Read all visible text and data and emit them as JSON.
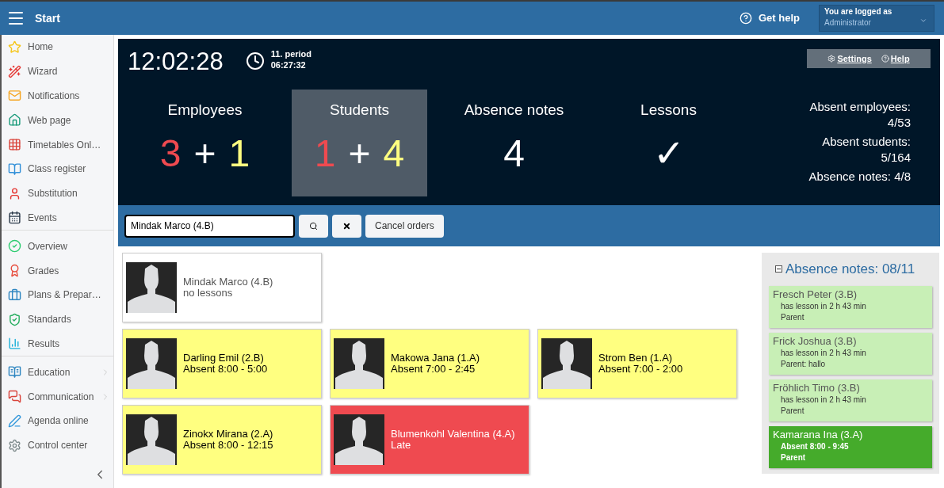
{
  "topbar": {
    "title": "Start",
    "help": "Get help",
    "user_label": "You are logged as",
    "user_name": "Administrator"
  },
  "sidebar": {
    "groups": [
      {
        "items": [
          {
            "label": "Home",
            "has_submenu": false
          },
          {
            "label": "Wizard",
            "has_submenu": false
          },
          {
            "label": "Notifications",
            "has_submenu": false
          },
          {
            "label": "Web page",
            "has_submenu": false
          },
          {
            "label": "Timetables Onl…",
            "has_submenu": false
          },
          {
            "label": "Class register",
            "has_submenu": false
          },
          {
            "label": "Substitution",
            "has_submenu": false
          },
          {
            "label": "Events",
            "has_submenu": false
          }
        ]
      },
      {
        "items": [
          {
            "label": "Overview",
            "has_submenu": false
          },
          {
            "label": "Grades",
            "has_submenu": false
          },
          {
            "label": "Plans & Prepar…",
            "has_submenu": false
          },
          {
            "label": "Standards",
            "has_submenu": false
          },
          {
            "label": "Results",
            "has_submenu": false
          }
        ]
      },
      {
        "items": [
          {
            "label": "Education",
            "has_submenu": true
          },
          {
            "label": "Communication",
            "has_submenu": true
          },
          {
            "label": "Agenda online",
            "has_submenu": false
          },
          {
            "label": "Control center",
            "has_submenu": false
          }
        ]
      }
    ]
  },
  "dashboard": {
    "clock": "12:02:28",
    "period": "11. period",
    "period_time": "06:27:32",
    "settings": "Settings",
    "help": "Help",
    "tiles": [
      {
        "title": "Employees",
        "selected": false,
        "parts": [
          {
            "text": "3",
            "color": "#ef4a50"
          },
          {
            "text": "+",
            "color": "#ffffff"
          },
          {
            "text": "1",
            "color": "#ffff80"
          }
        ]
      },
      {
        "title": "Students",
        "selected": true,
        "parts": [
          {
            "text": "1",
            "color": "#ef4a50"
          },
          {
            "text": "+",
            "color": "#ffffff"
          },
          {
            "text": "4",
            "color": "#ffff80"
          }
        ]
      },
      {
        "title": "Absence notes",
        "selected": false,
        "parts": [
          {
            "text": "4",
            "color": "#ffffff"
          }
        ]
      },
      {
        "title": "Lessons",
        "selected": false,
        "parts": [
          {
            "text": "✓",
            "color": "#ffffff"
          }
        ]
      }
    ],
    "stats": [
      "Absent employees: 4/53",
      "Absent students: 5/164",
      "Absence notes: 4/8"
    ]
  },
  "search": {
    "value": "Mindak Marco (4.B)",
    "cancel": "Cancel orders"
  },
  "people": [
    [
      {
        "name": "Mindak Marco (4.B)",
        "status_text": "no lessons",
        "kind": "none"
      }
    ],
    [
      {
        "name": "Darling Emil (2.B)",
        "status_text": "Absent 8:00 - 5:00",
        "kind": "absent"
      },
      {
        "name": "Makowa Jana (1.A)",
        "status_text": "Absent 7:00 - 2:45",
        "kind": "absent"
      },
      {
        "name": "Strom Ben (1.A)",
        "status_text": "Absent 7:00 - 2:00",
        "kind": "absent"
      }
    ],
    [
      {
        "name": "Zinokx Mirana (2.A)",
        "status_text": "Absent 8:00 - 12:15",
        "kind": "absent"
      },
      {
        "name": "Blumenkohl Valentina (4.A)",
        "status_text": "Late",
        "kind": "late"
      }
    ]
  ],
  "absence_notes": {
    "title": "Absence notes: 08/11",
    "expanded": true,
    "notes": [
      {
        "name": "Fresch Peter (3.B)",
        "detail": "has lesson in 2 h 43 min",
        "source": "Parent",
        "highlighted": false
      },
      {
        "name": "Frick Joshua (3.B)",
        "detail": "has lesson in 2 h 43 min",
        "source": "Parent: hallo",
        "highlighted": false
      },
      {
        "name": "Fröhlich Timo (3.B)",
        "detail": "has lesson in 2 h 43 min",
        "source": "Parent",
        "highlighted": false
      },
      {
        "name": "Kamarana Ina (3.A)",
        "detail": "Absent 8:00 - 9:45",
        "source": "Parent",
        "highlighted": true
      }
    ]
  }
}
